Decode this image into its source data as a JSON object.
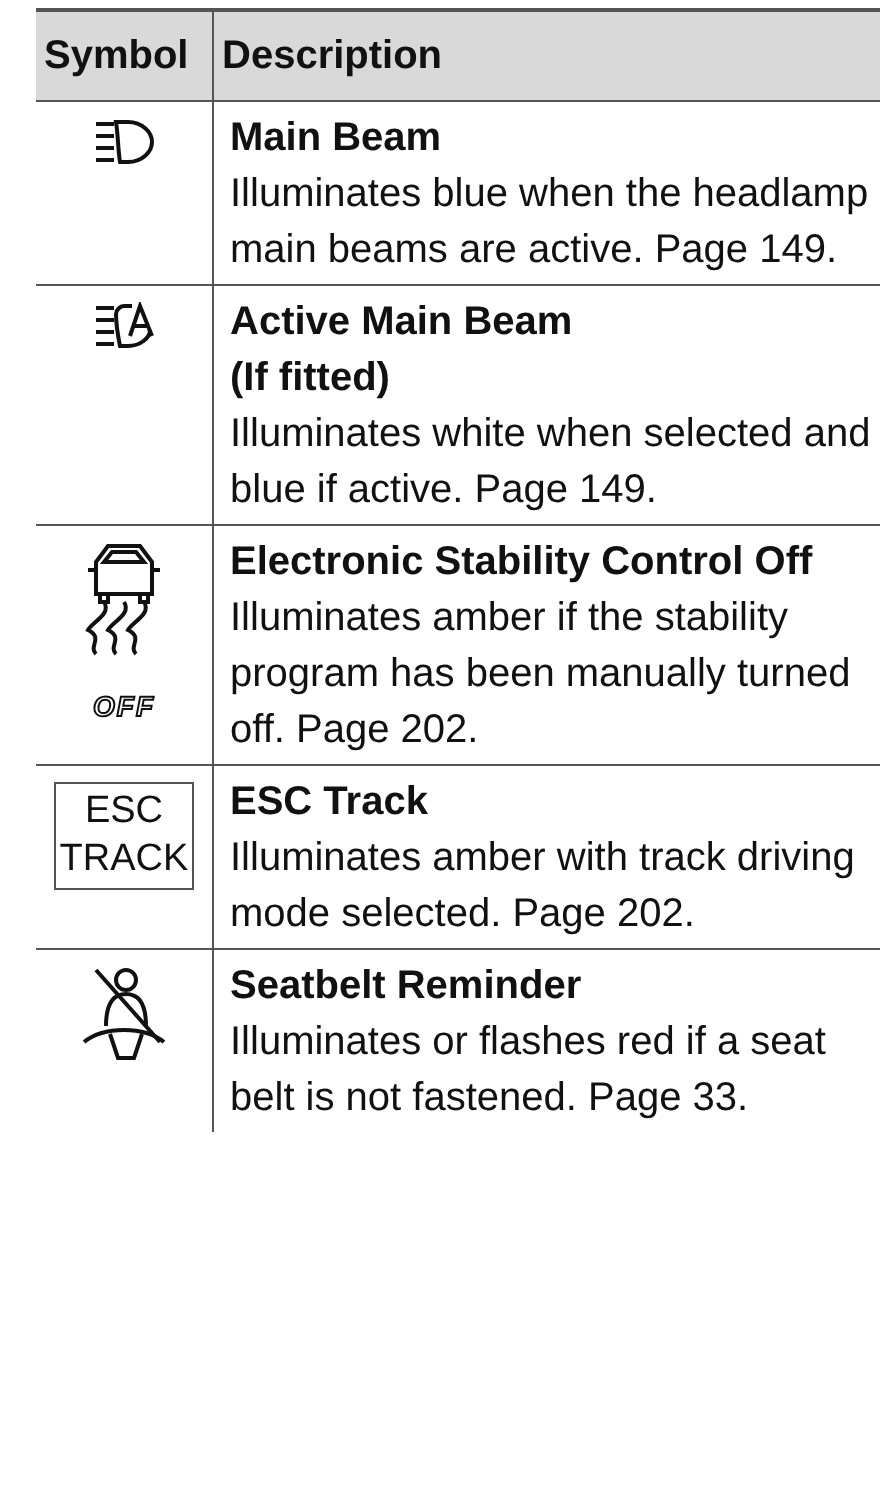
{
  "table": {
    "columns": [
      "Symbol",
      "Description"
    ],
    "rows": [
      {
        "symbol": {
          "kind": "main-beam"
        },
        "title": "Main Beam",
        "description": "Illuminates blue when the headlamp main beams are active. Page 149."
      },
      {
        "symbol": {
          "kind": "active-main-beam"
        },
        "title": "Active Main Beam",
        "subtitle": "(If fitted)",
        "description": "Illuminates white when selected and blue if active. Page 149."
      },
      {
        "symbol": {
          "kind": "esc-off",
          "text": "OFF"
        },
        "title": "Electronic Stability Control Off",
        "description": "Illuminates amber if the stability program has been manually turned off. Page 202."
      },
      {
        "symbol": {
          "kind": "esc-track",
          "lines": [
            "ESC",
            "TRACK"
          ]
        },
        "title": "ESC Track",
        "description": "Illuminates amber with track driving mode selected. Page 202."
      },
      {
        "symbol": {
          "kind": "seatbelt"
        },
        "title": "Seatbelt Reminder",
        "description": "Illuminates or flashes red if a seat belt is not fastened. Page 33."
      }
    ]
  }
}
